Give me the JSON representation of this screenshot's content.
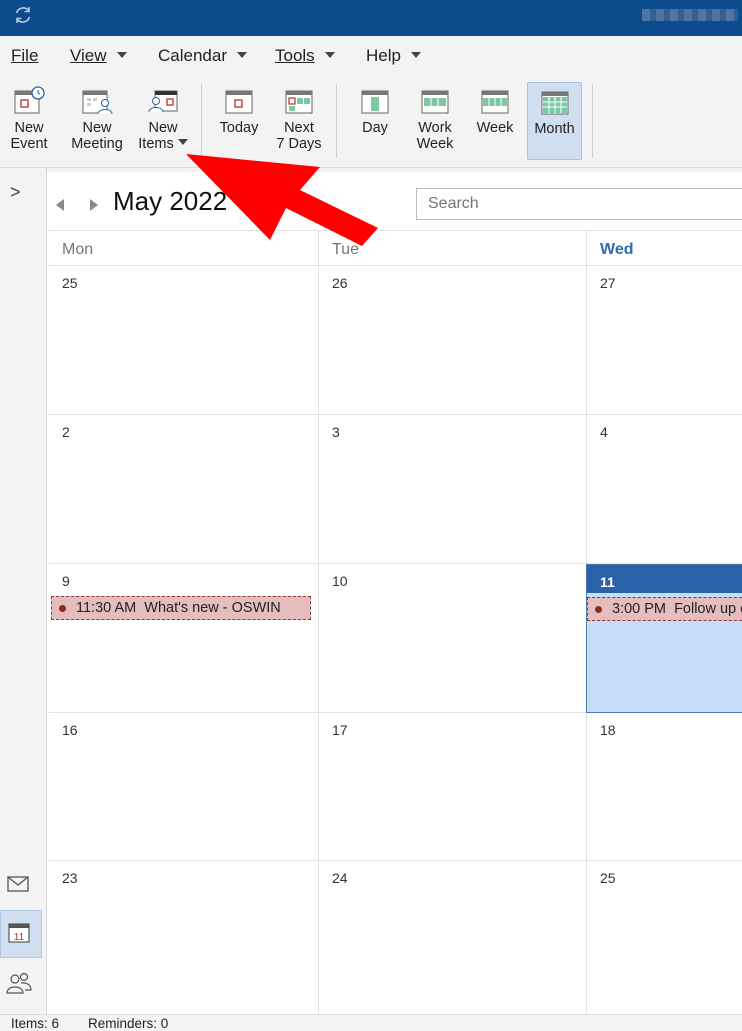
{
  "menubar": {
    "items": [
      {
        "label": "File",
        "dropdown": false
      },
      {
        "label": "View",
        "dropdown": true
      },
      {
        "label": "Calendar",
        "dropdown": true
      },
      {
        "label": "Tools",
        "dropdown": true
      },
      {
        "label": "Help",
        "dropdown": true
      }
    ]
  },
  "ribbon": {
    "new_event": {
      "line1": "New",
      "line2": "Event",
      "icon": "calendar-clock-icon"
    },
    "new_meeting": {
      "line1": "New",
      "line2": "Meeting",
      "icon": "calendar-people-icon"
    },
    "new_items": {
      "line1": "New",
      "line2": "Items",
      "icon": "calendar-person-icon"
    },
    "today": {
      "line1": "Today",
      "icon": "calendar-today-icon"
    },
    "next7": {
      "line1": "Next",
      "line2": "7 Days",
      "icon": "calendar-next7-icon"
    },
    "day": {
      "line1": "Day",
      "icon": "calendar-day-icon"
    },
    "work_week": {
      "line1": "Work",
      "line2": "Week",
      "icon": "calendar-workweek-icon"
    },
    "week": {
      "line1": "Week",
      "icon": "calendar-week-icon"
    },
    "month": {
      "line1": "Month",
      "icon": "calendar-month-icon",
      "active": true
    }
  },
  "calendar": {
    "title": "May 2022",
    "search_placeholder": "Search",
    "days": [
      "Mon",
      "Tue",
      "Wed"
    ],
    "today_column": "Wed",
    "weeks": [
      [
        "25",
        "26",
        "27"
      ],
      [
        "2",
        "3",
        "4"
      ],
      [
        "9",
        "10",
        "11"
      ],
      [
        "16",
        "17",
        "18"
      ],
      [
        "23",
        "24",
        "25"
      ]
    ],
    "today": "11",
    "events": [
      {
        "time": "11:30 AM",
        "title": "What's new - OSWIN",
        "day": "9"
      },
      {
        "time": "3:00 PM",
        "title": "Follow up c",
        "day": "11"
      }
    ]
  },
  "status": {
    "items": "Items: 6",
    "reminders": "Reminders: 0"
  },
  "colors": {
    "titlebar": "#0b4a8b",
    "accent": "#2a61a8",
    "event_fill": "#e6bdbd",
    "annotation_arrow": "#ff0000"
  }
}
